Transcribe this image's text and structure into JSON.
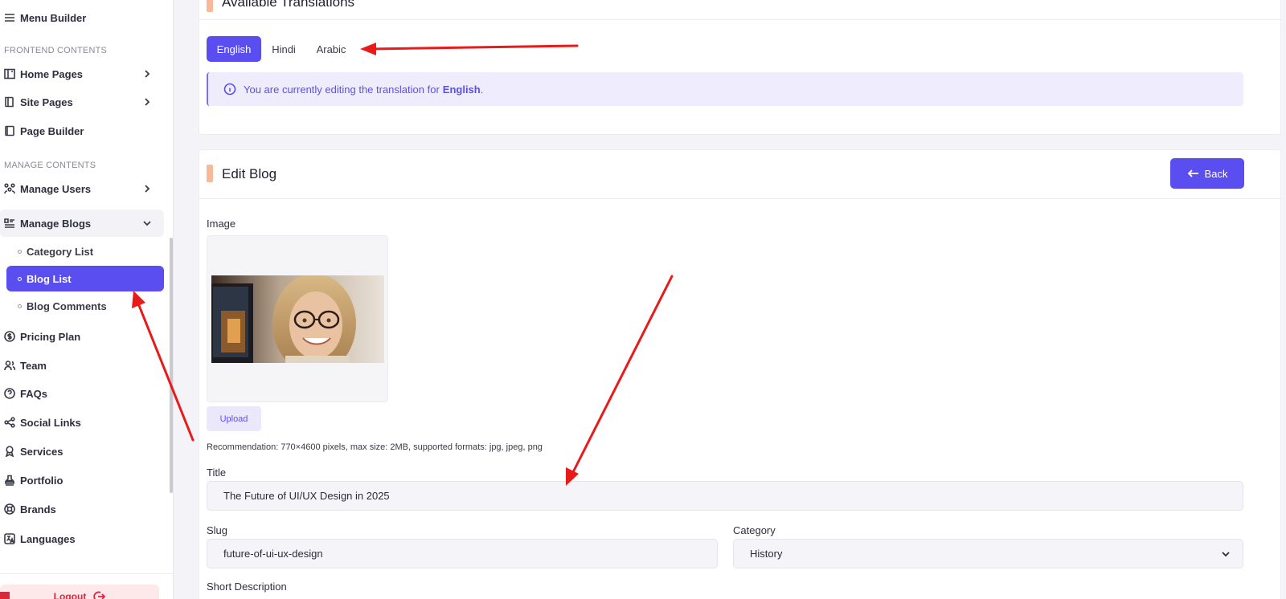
{
  "sidebar": {
    "menu_builder": "Menu Builder",
    "section_frontend": "FRONTEND CONTENTS",
    "home_pages": "Home Pages",
    "site_pages": "Site Pages",
    "page_builder": "Page Builder",
    "section_manage": "MANAGE CONTENTS",
    "manage_users": "Manage Users",
    "manage_blogs": "Manage Blogs",
    "category_list": "Category List",
    "blog_list": "Blog List",
    "blog_comments": "Blog Comments",
    "pricing_plan": "Pricing Plan",
    "team": "Team",
    "faqs": "FAQs",
    "social_links": "Social Links",
    "services": "Services",
    "portfolio": "Portfolio",
    "brands": "Brands",
    "languages": "Languages",
    "logout": "Logout"
  },
  "translations": {
    "title": "Available Translations",
    "tabs": [
      "English",
      "Hindi",
      "Arabic"
    ],
    "active_tab": "English",
    "notice_prefix": "You are currently editing the translation for",
    "notice_lang": "English",
    "notice_suffix": "."
  },
  "edit_blog": {
    "title": "Edit Blog",
    "back_label": "Back",
    "image_label": "Image",
    "upload_label": "Upload",
    "recommendation": "Recommendation: 770×4600 pixels, max size: 2MB, supported formats: jpg, jpeg, png",
    "title_label": "Title",
    "title_value": "The Future of UI/UX Design in 2025",
    "slug_label": "Slug",
    "slug_value": "future-of-ui-ux-design",
    "category_label": "Category",
    "category_value": "History",
    "short_description_label": "Short Description"
  },
  "colors": {
    "accent": "#5b4ef0",
    "annotation": "#e81a1a"
  }
}
